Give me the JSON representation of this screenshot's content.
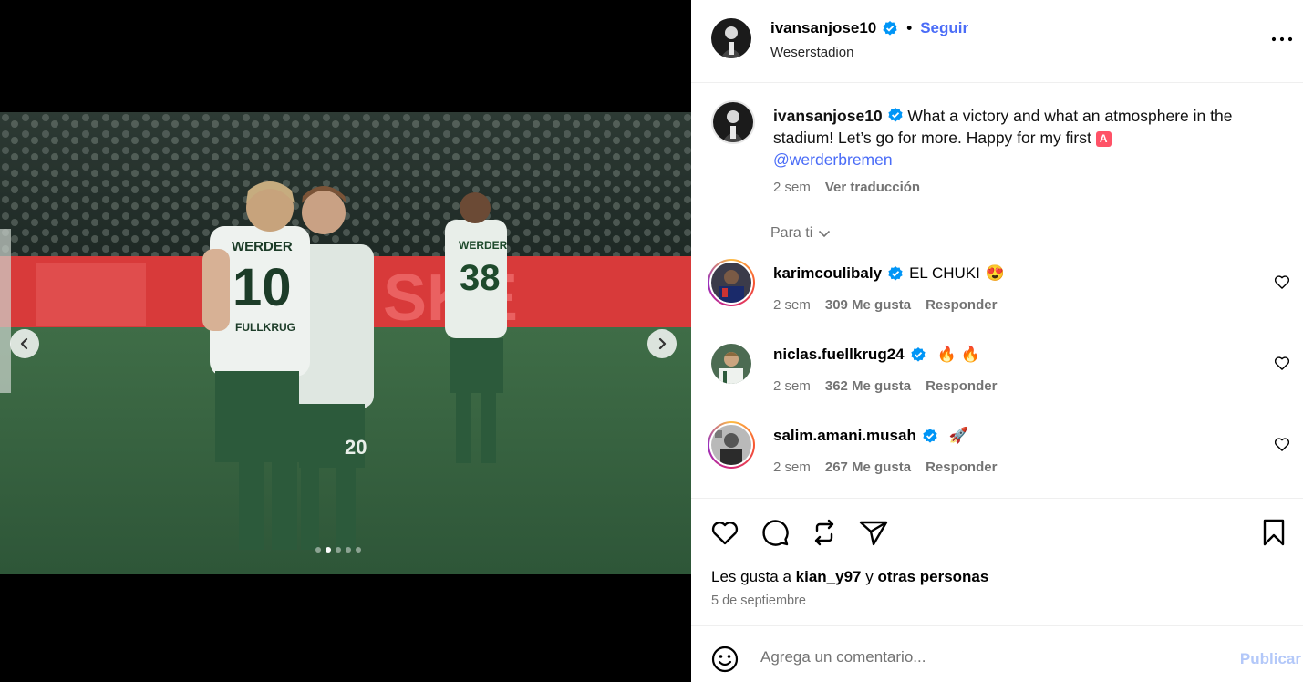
{
  "post": {
    "author": "ivansanjose10",
    "follow_label": "Seguir",
    "separator": "•",
    "location": "Weserstadion"
  },
  "photo": {
    "players": [
      {
        "name_top": "WERDER",
        "number": "10",
        "name_bottom": "FULLKRUG"
      },
      {
        "number": "20"
      },
      {
        "name_top": "WERDER",
        "number": "38"
      }
    ],
    "ad_text": "SKE",
    "slides_total": 5,
    "slide_active": 2
  },
  "caption": {
    "username": "ivansanjose10",
    "text": "What a victory and what an atmosphere in the stadium! Let’s go for more. Happy for my first",
    "emoji": "A",
    "mention": "@werderbremen",
    "time": "2 sem",
    "translate": "Ver traducción"
  },
  "filter": {
    "label": "Para ti"
  },
  "comments": [
    {
      "username": "karimcoulibaly",
      "text": "EL CHUKI",
      "emoji": "😍",
      "time": "2 sem",
      "likes": "309 Me gusta",
      "reply": "Responder"
    },
    {
      "username": "niclas.fuellkrug24",
      "text": "",
      "emoji": "🔥 🔥",
      "time": "2 sem",
      "likes": "362 Me gusta",
      "reply": "Responder"
    },
    {
      "username": "salim.amani.musah",
      "text": "",
      "emoji": "🚀",
      "time": "2 sem",
      "likes": "267 Me gusta",
      "reply": "Responder"
    }
  ],
  "liked": {
    "prefix": "Les gusta a",
    "user": "kian_y97",
    "middle": "y",
    "suffix": "otras personas"
  },
  "date": "5 de septiembre",
  "composer": {
    "placeholder": "Agrega un comentario...",
    "publish": "Publicar"
  },
  "colors": {
    "link": "#4a6cf7",
    "verified": "#0095f6",
    "muted": "#737373",
    "publish_disabled": "#b3c8f9"
  },
  "icons": [
    "more-options-icon",
    "verified-icon",
    "chevron-down-icon",
    "heart-icon",
    "comment-icon",
    "repost-icon",
    "share-icon",
    "bookmark-icon",
    "emoji-icon",
    "chevron-left-icon",
    "chevron-right-icon"
  ]
}
